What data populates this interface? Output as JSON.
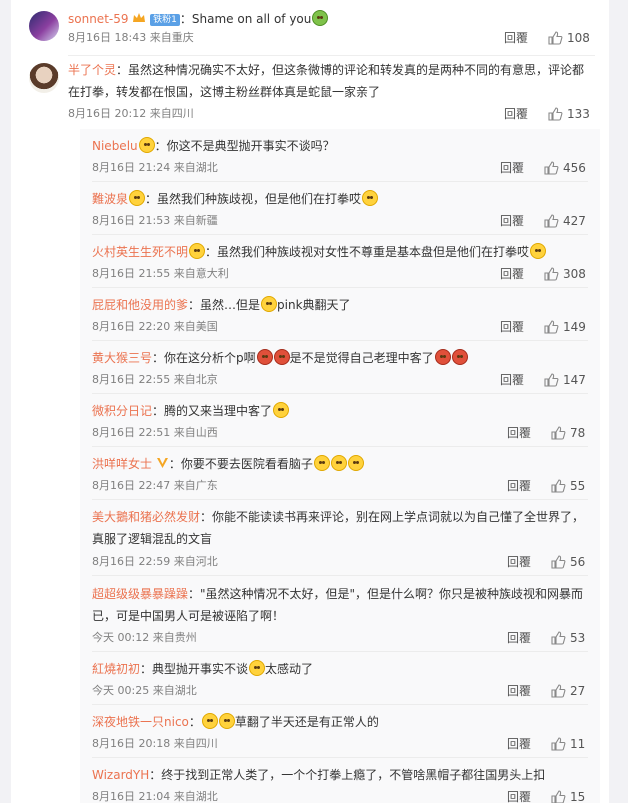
{
  "comments": [
    {
      "user": "sonnet-59",
      "level_badge": "铁粉1",
      "text": "：Shame on all of you",
      "time": "8月16日 18:43",
      "location": "来自重庆",
      "reply_label": "回覆",
      "likes": "108",
      "emoji": "sick-face-icon"
    },
    {
      "user": "半了个灵",
      "text": "：虽然这种情况确实不太好，但这条微博的评论和转发真的是两种不同的有意思，评论都在打拳，转发都在恨国，这博主粉丝群体真是蛇鼠一家亲了",
      "time": "8月16日 20:12",
      "location": "来自四川",
      "reply_label": "回覆",
      "likes": "133"
    }
  ],
  "replies": [
    {
      "user": "Niebelu",
      "text": "：你这不是典型抛开事实不谈吗？",
      "time": "8月16日 21:24",
      "location": "来自湖北",
      "reply_label": "回覆",
      "likes": "456"
    },
    {
      "user": "難波泉",
      "text": "：虽然我们种族歧视，但是他们在打拳哎",
      "time": "8月16日 21:53",
      "location": "来自新疆",
      "reply_label": "回覆",
      "likes": "427"
    },
    {
      "user": "火村英生生死不明",
      "text": "：虽然我们种族歧视对女性不尊重是基本盘但是他们在打拳哎",
      "time": "8月16日 21:55",
      "location": "来自意大利",
      "reply_label": "回覆",
      "likes": "308"
    },
    {
      "user": "屁屁和他没用的爹",
      "text": "：虽然…但是",
      "text2": "pink典翻天了",
      "time": "8月16日 22:20",
      "location": "来自美国",
      "reply_label": "回覆",
      "likes": "149"
    },
    {
      "user": "黄大猴三号",
      "text": "：你在这分析个p啊",
      "text2": "是不是觉得自己老理中客了",
      "time": "8月16日 22:55",
      "location": "来自北京",
      "reply_label": "回覆",
      "likes": "147"
    },
    {
      "user": "微积分日记",
      "text": "：腾的又来当理中客了",
      "time": "8月16日 22:51",
      "location": "来自山西",
      "reply_label": "回覆",
      "likes": "78"
    },
    {
      "user": "洪咩咩女士",
      "text": "：你要不要去医院看看脑子",
      "time": "8月16日 22:47",
      "location": "来自广东",
      "reply_label": "回覆",
      "likes": "55"
    },
    {
      "user": "美大鵝和猪必然发财",
      "text": "：你能不能读读书再来评论，别在网上学点词就以为自己懂了全世界了，真服了逻辑混乱的文盲",
      "time": "8月16日 22:59",
      "location": "来自河北",
      "reply_label": "回覆",
      "likes": "56"
    },
    {
      "user": "超超级级暴暴躁躁",
      "text": "：\"虽然这种情况不太好，但是\"，但是什么啊？你只是被种族歧视和网暴而已，可是中国男人可是被诬陷了啊！",
      "time": "今天 00:12",
      "location": "来自贵州",
      "reply_label": "回覆",
      "likes": "53"
    },
    {
      "user": "紅燒初初",
      "text": "：典型抛开事实不谈",
      "text2": "太感动了",
      "time": "今天 00:25",
      "location": "来自湖北",
      "reply_label": "回覆",
      "likes": "27"
    },
    {
      "user": "深夜地铁一只nico",
      "text": "：",
      "text2": "草翻了半天还是有正常人的",
      "time": "8月16日 20:18",
      "location": "来自四川",
      "reply_label": "回覆",
      "likes": "11"
    },
    {
      "user": "WizardYH",
      "text": "：终于找到正常人类了，一个个打拳上瘾了，不管啥黑帽子都往国男头上扣",
      "time": "8月16日 21:04",
      "location": "来自湖北",
      "reply_label": "回覆",
      "likes": "15"
    }
  ],
  "colors": {
    "username": "#eb7350",
    "meta": "#808080",
    "sub_bg": "#f9f9fa"
  }
}
